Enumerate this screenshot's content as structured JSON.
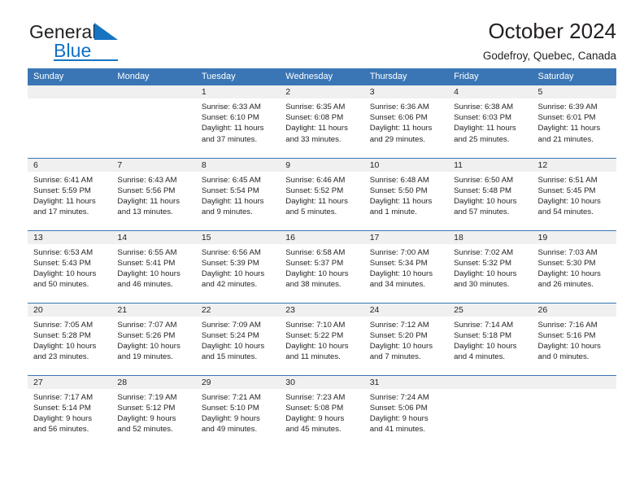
{
  "brand": {
    "name_part1": "General",
    "name_part2": "Blue",
    "triangle_color": "#1674c0"
  },
  "header": {
    "title": "October 2024",
    "location": "Godefroy, Quebec, Canada"
  },
  "theme": {
    "header_blue": "#3a76b5",
    "daynum_band": "#f0f0f0",
    "text": "#231f20"
  },
  "weekday_headers": [
    "Sunday",
    "Monday",
    "Tuesday",
    "Wednesday",
    "Thursday",
    "Friday",
    "Saturday"
  ],
  "labels": {
    "sunrise_prefix": "Sunrise: ",
    "sunset_prefix": "Sunset: ",
    "daylight_prefix": "Daylight: "
  },
  "weeks": [
    [
      {
        "day": "",
        "sunrise": "",
        "sunset": "",
        "daylight_line1": "",
        "daylight_line2": "",
        "empty": true
      },
      {
        "day": "",
        "sunrise": "",
        "sunset": "",
        "daylight_line1": "",
        "daylight_line2": "",
        "empty": true
      },
      {
        "day": "1",
        "sunrise": "Sunrise: 6:33 AM",
        "sunset": "Sunset: 6:10 PM",
        "daylight_line1": "Daylight: 11 hours",
        "daylight_line2": "and 37 minutes."
      },
      {
        "day": "2",
        "sunrise": "Sunrise: 6:35 AM",
        "sunset": "Sunset: 6:08 PM",
        "daylight_line1": "Daylight: 11 hours",
        "daylight_line2": "and 33 minutes."
      },
      {
        "day": "3",
        "sunrise": "Sunrise: 6:36 AM",
        "sunset": "Sunset: 6:06 PM",
        "daylight_line1": "Daylight: 11 hours",
        "daylight_line2": "and 29 minutes."
      },
      {
        "day": "4",
        "sunrise": "Sunrise: 6:38 AM",
        "sunset": "Sunset: 6:03 PM",
        "daylight_line1": "Daylight: 11 hours",
        "daylight_line2": "and 25 minutes."
      },
      {
        "day": "5",
        "sunrise": "Sunrise: 6:39 AM",
        "sunset": "Sunset: 6:01 PM",
        "daylight_line1": "Daylight: 11 hours",
        "daylight_line2": "and 21 minutes."
      }
    ],
    [
      {
        "day": "6",
        "sunrise": "Sunrise: 6:41 AM",
        "sunset": "Sunset: 5:59 PM",
        "daylight_line1": "Daylight: 11 hours",
        "daylight_line2": "and 17 minutes."
      },
      {
        "day": "7",
        "sunrise": "Sunrise: 6:43 AM",
        "sunset": "Sunset: 5:56 PM",
        "daylight_line1": "Daylight: 11 hours",
        "daylight_line2": "and 13 minutes."
      },
      {
        "day": "8",
        "sunrise": "Sunrise: 6:45 AM",
        "sunset": "Sunset: 5:54 PM",
        "daylight_line1": "Daylight: 11 hours",
        "daylight_line2": "and 9 minutes."
      },
      {
        "day": "9",
        "sunrise": "Sunrise: 6:46 AM",
        "sunset": "Sunset: 5:52 PM",
        "daylight_line1": "Daylight: 11 hours",
        "daylight_line2": "and 5 minutes."
      },
      {
        "day": "10",
        "sunrise": "Sunrise: 6:48 AM",
        "sunset": "Sunset: 5:50 PM",
        "daylight_line1": "Daylight: 11 hours",
        "daylight_line2": "and 1 minute."
      },
      {
        "day": "11",
        "sunrise": "Sunrise: 6:50 AM",
        "sunset": "Sunset: 5:48 PM",
        "daylight_line1": "Daylight: 10 hours",
        "daylight_line2": "and 57 minutes."
      },
      {
        "day": "12",
        "sunrise": "Sunrise: 6:51 AM",
        "sunset": "Sunset: 5:45 PM",
        "daylight_line1": "Daylight: 10 hours",
        "daylight_line2": "and 54 minutes."
      }
    ],
    [
      {
        "day": "13",
        "sunrise": "Sunrise: 6:53 AM",
        "sunset": "Sunset: 5:43 PM",
        "daylight_line1": "Daylight: 10 hours",
        "daylight_line2": "and 50 minutes."
      },
      {
        "day": "14",
        "sunrise": "Sunrise: 6:55 AM",
        "sunset": "Sunset: 5:41 PM",
        "daylight_line1": "Daylight: 10 hours",
        "daylight_line2": "and 46 minutes."
      },
      {
        "day": "15",
        "sunrise": "Sunrise: 6:56 AM",
        "sunset": "Sunset: 5:39 PM",
        "daylight_line1": "Daylight: 10 hours",
        "daylight_line2": "and 42 minutes."
      },
      {
        "day": "16",
        "sunrise": "Sunrise: 6:58 AM",
        "sunset": "Sunset: 5:37 PM",
        "daylight_line1": "Daylight: 10 hours",
        "daylight_line2": "and 38 minutes."
      },
      {
        "day": "17",
        "sunrise": "Sunrise: 7:00 AM",
        "sunset": "Sunset: 5:34 PM",
        "daylight_line1": "Daylight: 10 hours",
        "daylight_line2": "and 34 minutes."
      },
      {
        "day": "18",
        "sunrise": "Sunrise: 7:02 AM",
        "sunset": "Sunset: 5:32 PM",
        "daylight_line1": "Daylight: 10 hours",
        "daylight_line2": "and 30 minutes."
      },
      {
        "day": "19",
        "sunrise": "Sunrise: 7:03 AM",
        "sunset": "Sunset: 5:30 PM",
        "daylight_line1": "Daylight: 10 hours",
        "daylight_line2": "and 26 minutes."
      }
    ],
    [
      {
        "day": "20",
        "sunrise": "Sunrise: 7:05 AM",
        "sunset": "Sunset: 5:28 PM",
        "daylight_line1": "Daylight: 10 hours",
        "daylight_line2": "and 23 minutes."
      },
      {
        "day": "21",
        "sunrise": "Sunrise: 7:07 AM",
        "sunset": "Sunset: 5:26 PM",
        "daylight_line1": "Daylight: 10 hours",
        "daylight_line2": "and 19 minutes."
      },
      {
        "day": "22",
        "sunrise": "Sunrise: 7:09 AM",
        "sunset": "Sunset: 5:24 PM",
        "daylight_line1": "Daylight: 10 hours",
        "daylight_line2": "and 15 minutes."
      },
      {
        "day": "23",
        "sunrise": "Sunrise: 7:10 AM",
        "sunset": "Sunset: 5:22 PM",
        "daylight_line1": "Daylight: 10 hours",
        "daylight_line2": "and 11 minutes."
      },
      {
        "day": "24",
        "sunrise": "Sunrise: 7:12 AM",
        "sunset": "Sunset: 5:20 PM",
        "daylight_line1": "Daylight: 10 hours",
        "daylight_line2": "and 7 minutes."
      },
      {
        "day": "25",
        "sunrise": "Sunrise: 7:14 AM",
        "sunset": "Sunset: 5:18 PM",
        "daylight_line1": "Daylight: 10 hours",
        "daylight_line2": "and 4 minutes."
      },
      {
        "day": "26",
        "sunrise": "Sunrise: 7:16 AM",
        "sunset": "Sunset: 5:16 PM",
        "daylight_line1": "Daylight: 10 hours",
        "daylight_line2": "and 0 minutes."
      }
    ],
    [
      {
        "day": "27",
        "sunrise": "Sunrise: 7:17 AM",
        "sunset": "Sunset: 5:14 PM",
        "daylight_line1": "Daylight: 9 hours",
        "daylight_line2": "and 56 minutes."
      },
      {
        "day": "28",
        "sunrise": "Sunrise: 7:19 AM",
        "sunset": "Sunset: 5:12 PM",
        "daylight_line1": "Daylight: 9 hours",
        "daylight_line2": "and 52 minutes."
      },
      {
        "day": "29",
        "sunrise": "Sunrise: 7:21 AM",
        "sunset": "Sunset: 5:10 PM",
        "daylight_line1": "Daylight: 9 hours",
        "daylight_line2": "and 49 minutes."
      },
      {
        "day": "30",
        "sunrise": "Sunrise: 7:23 AM",
        "sunset": "Sunset: 5:08 PM",
        "daylight_line1": "Daylight: 9 hours",
        "daylight_line2": "and 45 minutes."
      },
      {
        "day": "31",
        "sunrise": "Sunrise: 7:24 AM",
        "sunset": "Sunset: 5:06 PM",
        "daylight_line1": "Daylight: 9 hours",
        "daylight_line2": "and 41 minutes."
      },
      {
        "day": "",
        "sunrise": "",
        "sunset": "",
        "daylight_line1": "",
        "daylight_line2": "",
        "empty": true
      },
      {
        "day": "",
        "sunrise": "",
        "sunset": "",
        "daylight_line1": "",
        "daylight_line2": "",
        "empty": true
      }
    ]
  ]
}
